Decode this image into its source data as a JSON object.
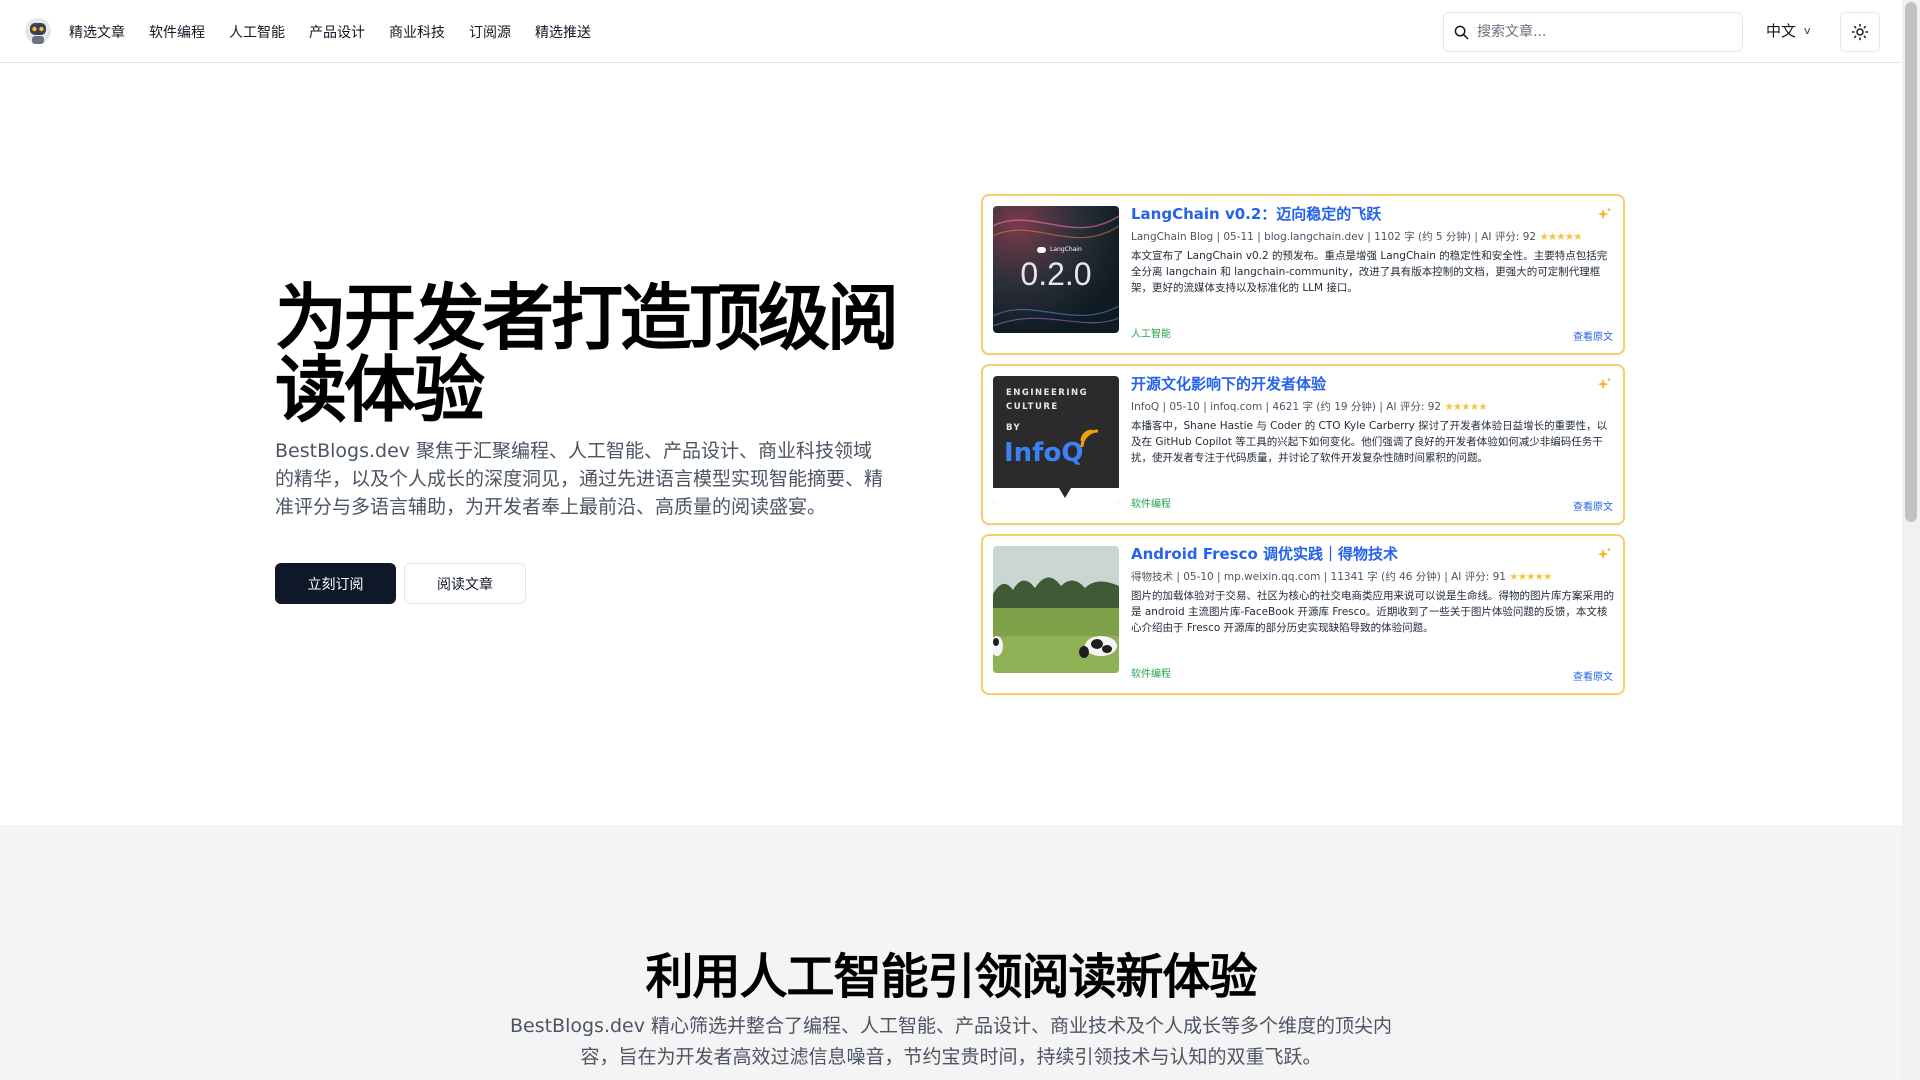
{
  "nav": {
    "items": [
      {
        "label": "精选文章"
      },
      {
        "label": "软件编程"
      },
      {
        "label": "人工智能"
      },
      {
        "label": "产品设计"
      },
      {
        "label": "商业科技"
      },
      {
        "label": "订阅源"
      },
      {
        "label": "精选推送"
      }
    ],
    "search_placeholder": "搜索文章...",
    "language": "中文",
    "theme_icon": "sun-icon"
  },
  "hero": {
    "title": "为开发者打造顶级阅读体验",
    "description": "BestBlogs.dev 聚焦于汇聚编程、人工智能、产品设计、商业科技领域的精华，以及个人成长的深度洞见，通过先进语言模型实现智能摘要、精准评分与多语言辅助，为开发者奉上最前沿、高质量的阅读盛宴。",
    "primary_button": "立刻订阅",
    "secondary_button": "阅读文章"
  },
  "articles": [
    {
      "title": "LangChain v0.2：迈向稳定的飞跃",
      "meta": "LangChain Blog | 05-11 | blog.langchain.dev | 1102 字 (约 5 分钟) | AI 评分: 92",
      "stars": "★★★★★",
      "summary": "本文宣布了 LangChain v0.2 的预发布。重点是增强 LangChain 的稳定性和安全性。主要特点包括完全分离 langchain 和 langchain-community，改进了具有版本控制的文档，更强大的可定制代理框架，更好的流媒体支持以及标准化的 LLM 接口。",
      "tag": "人工智能",
      "link_label": "查看原文",
      "thumb_label": "LangChain",
      "thumb_version": "0.2.0"
    },
    {
      "title": "开源文化影响下的开发者体验",
      "meta": "InfoQ | 05-10 | infoq.com | 4621 字 (约 19 分钟) | AI 评分: 92",
      "stars": "★★★★★",
      "summary": "本播客中，Shane Hastie 与 Coder 的 CTO Kyle Carberry 探讨了开发者体验日益增长的重要性，以及在 GitHub Copilot 等工具的兴起下如何变化。他们强调了良好的开发者体验如何减少非编码任务干扰，使开发者专注于代码质量，并讨论了软件开发复杂性随时间累积的问题。",
      "tag": "软件编程",
      "link_label": "查看原文",
      "thumb_lines": [
        "ENGINEERING",
        "CULTURE",
        "BY"
      ],
      "thumb_brand": "InfoQ"
    },
    {
      "title": "Android Fresco 调优实践｜得物技术",
      "meta": "得物技术 | 05-10 | mp.weixin.qq.com | 11341 字 (约 46 分钟) | AI 评分: 91",
      "stars": "★★★★★",
      "summary": "图片的加载体验对于交易、社区为核心的社交电商类应用来说可以说是生命线。得物的图片库方案采用的是 android 主流图片库-FaceBook 开源库 Fresco。近期收到了一些关于图片体验问题的反馈，本文核心介绍由于 Fresco 开源库的部分历史实现缺陷导致的体验问题。",
      "tag": "软件编程",
      "link_label": "查看原文"
    }
  ],
  "features": {
    "title": "利用人工智能引领阅读新体验",
    "description": "BestBlogs.dev 精心筛选并整合了编程、人工智能、产品设计、商业技术及个人成长等多个维度的顶尖内容，旨在为开发者高效过滤信息噪音，节约宝贵时间，持续引领技术与认知的双重飞跃。"
  },
  "colors": {
    "accent_blue": "#2563eb",
    "card_border": "#f5cf6b",
    "tag_green": "#22a34a",
    "primary_button": "#0f172a"
  }
}
